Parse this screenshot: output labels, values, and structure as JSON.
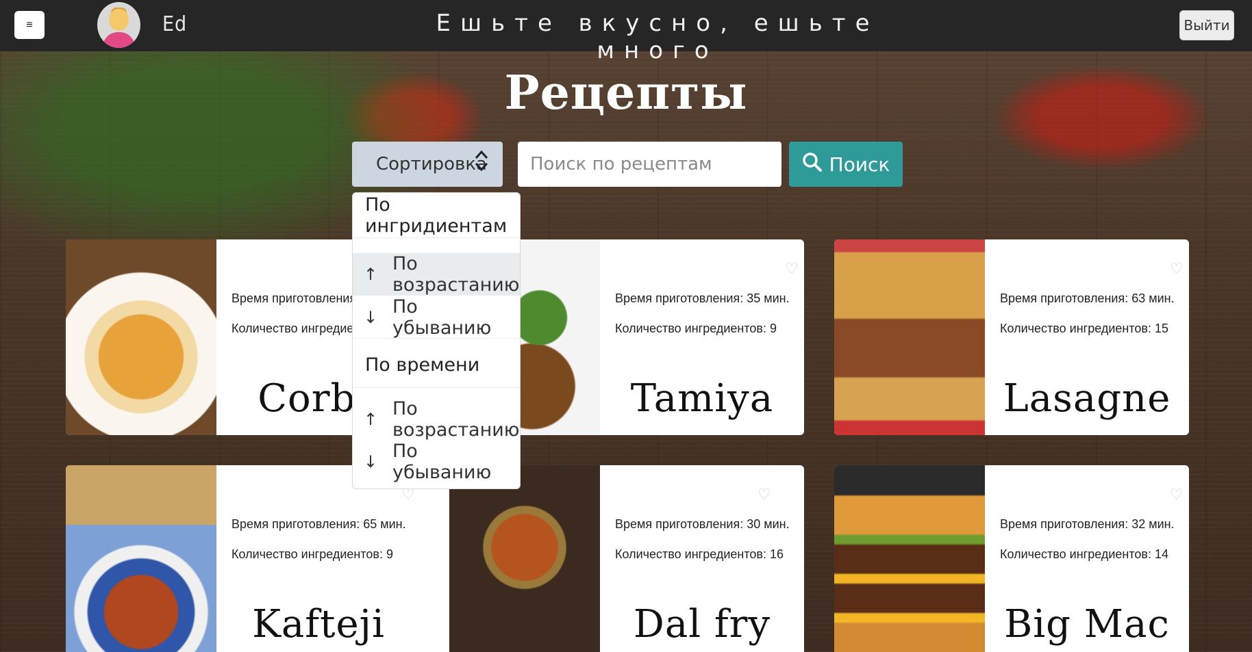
{
  "header": {
    "menu_icon": "≡",
    "username": "Ed",
    "tagline": "Ешьте вкусно, ешьте много",
    "logout_label": "Выйти"
  },
  "page_title": "Рецепты",
  "controls": {
    "sort_label": "Сортировка",
    "sort_icon": "⌃⌄",
    "search_placeholder": "Поиск по рецептам",
    "search_button_label": "Поиск"
  },
  "sort_dropdown": {
    "groups": [
      {
        "header": "По ингридиентам",
        "items": [
          {
            "label": "По возрастанию",
            "arrow": "↑",
            "active": true
          },
          {
            "label": "По убыванию",
            "arrow": "↓",
            "active": false
          }
        ]
      },
      {
        "header": "По времени",
        "items": [
          {
            "label": "По возрастанию",
            "arrow": "↑",
            "active": false
          },
          {
            "label": "По убыванию",
            "arrow": "↓",
            "active": false
          }
        ]
      }
    ]
  },
  "recipes": [
    {
      "title": "Corba",
      "time": "Время приготовления",
      "count": "Количество ингредие",
      "heart": "♡"
    },
    {
      "title": "Tamiya",
      "time": "Время приготовления: 35 мин.",
      "count": "Количество ингредиентов: 9",
      "heart": "♡"
    },
    {
      "title": "Lasagne",
      "time": "Время приготовления: 63 мин.",
      "count": "Количество ингредиентов: 15",
      "heart": "♡"
    },
    {
      "title": "Kafteji",
      "time": "Время приготовления: 65 мин.",
      "count": "Количество ингредиентов: 9",
      "heart": "♡"
    },
    {
      "title": "Dal fry",
      "time": "Время приготовления: 30 мин.",
      "count": "Количество ингредиентов: 16",
      "heart": "♡"
    },
    {
      "title": "Big Mac",
      "time": "Время приготовления: 32 мин.",
      "count": "Количество ингредиентов: 14",
      "heart": "♡"
    }
  ],
  "colors": {
    "topbar": "#262626",
    "search_button": "#2e9b98",
    "sort_button": "#ccd6e1"
  }
}
